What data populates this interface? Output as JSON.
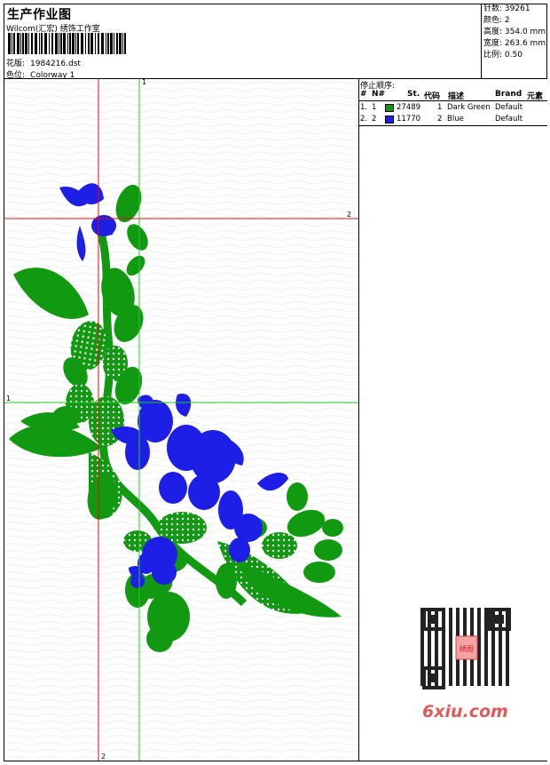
{
  "header": {
    "title": "生产作业图",
    "company": "Wilcom(汇宏) 绣饰工作室",
    "pattern_label": "花版:",
    "pattern_value": "1984216.dst",
    "colorway_label": "色位:",
    "colorway_value": "Colorway 1"
  },
  "stats": [
    {
      "label": "针数:",
      "value": "39261"
    },
    {
      "label": "颜色:",
      "value": "2"
    },
    {
      "label": "高度:",
      "value": "354.0 mm"
    },
    {
      "label": "宽度:",
      "value": "263.6 mm"
    },
    {
      "label": "比例:",
      "value": "0.50"
    }
  ],
  "stop_sequence": {
    "title": "停止顺序:",
    "columns": [
      "#",
      "N#",
      "St.",
      "代码",
      "描述",
      "Brand",
      "元素"
    ],
    "rows": [
      {
        "num": "1.",
        "n": "1",
        "color": "#119911",
        "stitches": "27489",
        "code": "1",
        "desc": "Dark Green",
        "brand": "Default"
      },
      {
        "num": "2.",
        "n": "2",
        "color": "#1d1ee6",
        "stitches": "11770",
        "code": "2",
        "desc": "Blue",
        "brand": "Default"
      }
    ]
  },
  "guides": {
    "v1_label": "1",
    "h1_label": "1",
    "h2_label": "2",
    "v2_label": "2"
  },
  "colors": {
    "green": "#119911",
    "blue": "#1d1ee6",
    "red_guide": "#e01010",
    "green_guide": "#22cc22"
  },
  "watermark": {
    "text": "6xiu.com",
    "qr_badge": "绣图"
  }
}
